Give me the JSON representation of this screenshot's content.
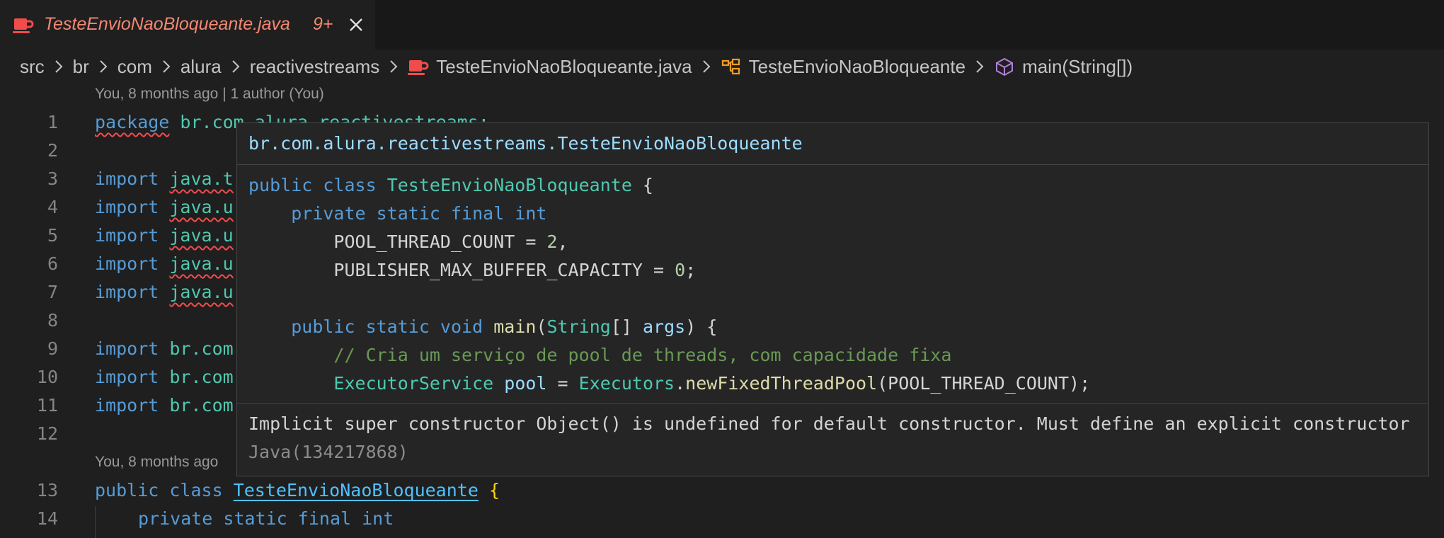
{
  "tab": {
    "title": "TesteEnvioNaoBloqueante.java",
    "badge": "9+",
    "icon": "java-cup-icon",
    "close_icon": "close-icon"
  },
  "breadcrumb": {
    "items": [
      "src",
      "br",
      "com",
      "alura",
      "reactivestreams",
      "TesteEnvioNaoBloqueante.java",
      "TesteEnvioNaoBloqueante",
      "main(String[])"
    ]
  },
  "codelens": {
    "top": "You, 8 months ago | 1 author (You)",
    "class": "You, 8 months ago"
  },
  "editor": {
    "line_numbers": [
      "1",
      "2",
      "3",
      "4",
      "5",
      "6",
      "7",
      "8",
      "9",
      "10",
      "11",
      "12",
      "13",
      "14"
    ],
    "line1": {
      "kw": "package",
      "pkg": "br.com.alura.reactivestreams;"
    },
    "import_kw": "import",
    "imports": [
      "java.t",
      "java.u",
      "java.u",
      "java.u",
      "java.u"
    ],
    "imports2": [
      "br.com",
      "br.com",
      "br.com"
    ],
    "line13": {
      "kw1": "public",
      "kw2": "class",
      "cls": "TesteEnvioNaoBloqueante",
      "brace": "{"
    },
    "line14": {
      "kw1": "private",
      "kw2": "static",
      "kw3": "final",
      "kw4": "int"
    }
  },
  "hover": {
    "title": "br.com.alura.reactivestreams.TesteEnvioNaoBloqueante",
    "snippet": {
      "l1": {
        "kw": "public class",
        "cls": "TesteEnvioNaoBloqueante",
        "rest": " {"
      },
      "l2": {
        "kw": "private static final int"
      },
      "l3": {
        "name": "POOL_THREAD_COUNT",
        "eq": " = ",
        "num": "2",
        "end": ","
      },
      "l4": {
        "name": "PUBLISHER_MAX_BUFFER_CAPACITY",
        "eq": " = ",
        "num": "0",
        "end": ";"
      },
      "l6": {
        "kw": "public static void",
        "fn": "main",
        "p1": "(",
        "cls": "String",
        "p2": "[] ",
        "var": "args",
        "p3": ") {"
      },
      "l7": {
        "comment": "// Cria um serviço de pool de threads, com capacidade fixa"
      },
      "l8": {
        "cls": "ExecutorService",
        "var": "pool",
        "eq": " = ",
        "cls2": "Executors",
        "dot": ".",
        "fn": "newFixedThreadPool",
        "arg": "(POOL_THREAD_COUNT);"
      }
    },
    "problem": {
      "message": "Implicit super constructor Object() is undefined for default constructor. Must define an explicit constructor",
      "source": "Java(134217868)"
    }
  },
  "colors": {
    "background": "#1f1f1f",
    "error_tab": "#f48771",
    "keyword": "#569cd6",
    "type": "#4ec9b0",
    "hover_bg": "#252526"
  }
}
